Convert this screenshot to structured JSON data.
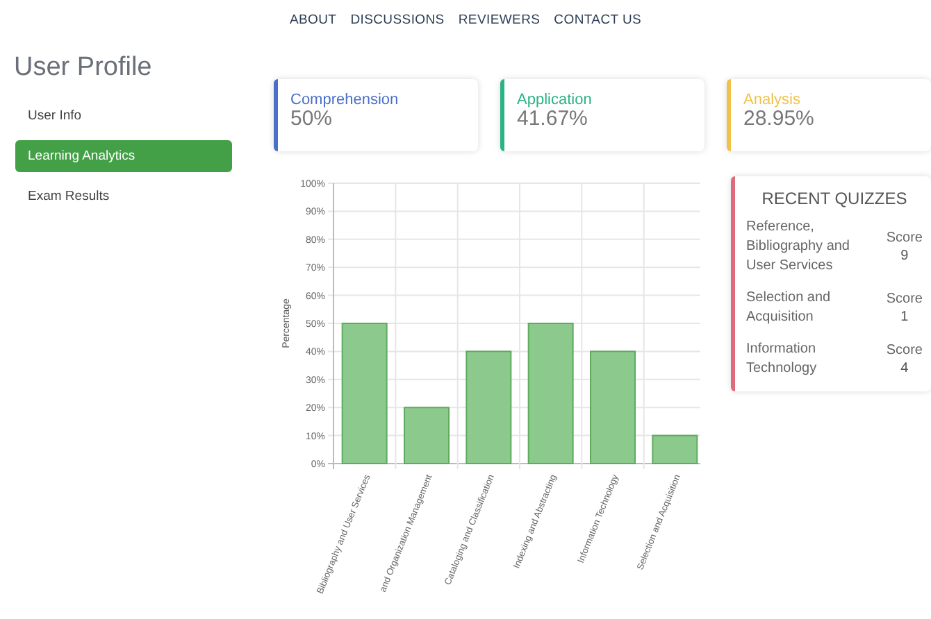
{
  "nav": [
    "ABOUT",
    "DISCUSSIONS",
    "REVIEWERS",
    "CONTACT US"
  ],
  "page_title": "User Profile",
  "sidebar": {
    "items": [
      {
        "label": "User Info",
        "selected": false
      },
      {
        "label": "Learning Analytics",
        "selected": true
      },
      {
        "label": "Exam Results",
        "selected": false
      }
    ]
  },
  "stats": [
    {
      "label": "Comprehension",
      "value": "50%",
      "color": "#4a6fc9"
    },
    {
      "label": "Application",
      "value": "41.67%",
      "color": "#2bb383"
    },
    {
      "label": "Analysis",
      "value": "28.95%",
      "color": "#f0c24a"
    }
  ],
  "chart": {
    "chart_data": {
      "type": "bar",
      "ylabel": "Percentage",
      "categories": [
        "Bibliography and User Services",
        "and Organization Management",
        "Cataloging and Classification",
        "Indexing and Abstracting",
        "Information Technology",
        "Selection and Acquisition"
      ],
      "values": [
        50,
        20,
        40,
        50,
        40,
        10
      ],
      "grid": true,
      "ylim": [
        0,
        100
      ],
      "yticks": [
        {
          "value": 0,
          "label": "0%"
        },
        {
          "value": 10,
          "label": "10%"
        },
        {
          "value": 20,
          "label": "20%"
        },
        {
          "value": 30,
          "label": "30%"
        },
        {
          "value": 40,
          "label": "40%"
        },
        {
          "value": 50,
          "label": "50%"
        },
        {
          "value": 60,
          "label": "60%"
        },
        {
          "value": 70,
          "label": "70%"
        },
        {
          "value": 80,
          "label": "80%"
        },
        {
          "value": 90,
          "label": "90%"
        },
        {
          "value": 100,
          "label": "100%"
        }
      ]
    }
  },
  "recent_quizzes": {
    "title": "RECENT QUIZZES",
    "color": "#e06b7c",
    "items": [
      {
        "name": "Reference, Bibliography and User Services",
        "score_label": "Score",
        "score": "9"
      },
      {
        "name": "Selection and Acquisition",
        "score_label": "Score",
        "score": "1"
      },
      {
        "name": "Information Technology",
        "score_label": "Score",
        "score": "4"
      }
    ]
  }
}
